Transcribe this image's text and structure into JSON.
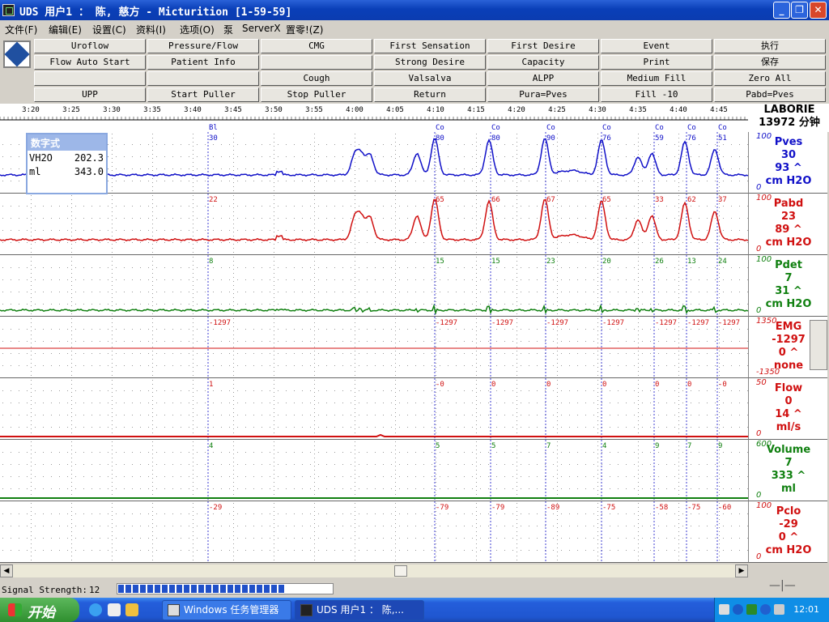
{
  "window": {
    "title": "UDS 用户1 ： 陈, 慈方 - Micturition [1-59-59]",
    "min": "_",
    "restore": "❐",
    "close": "✕"
  },
  "menu": [
    "文件(F)",
    "编辑(E)",
    "设置(C)",
    "资料(I)",
    "选项(O)",
    "泵",
    "ServerX",
    "置零!(Z)"
  ],
  "toolbar": [
    [
      "Uroflow",
      "Pressure/Flow",
      "CMG",
      "First Sensation",
      "First Desire",
      "Event",
      "执行"
    ],
    [
      "Flow Auto Start",
      "Patient Info",
      "",
      "Strong Desire",
      "Capacity",
      "Print",
      "保存"
    ],
    [
      "",
      "",
      "Cough",
      "Valsalva",
      "ALPP",
      "Medium Fill",
      "Zero All"
    ],
    [
      "UPP",
      "Start Puller",
      "Stop Puller",
      "Return",
      "Pura=Pves",
      "Fill -10",
      "Pabd=Pves"
    ]
  ],
  "timeline": {
    "ticks": [
      "3:20",
      "3:25",
      "3:30",
      "3:35",
      "3:40",
      "3:45",
      "3:50",
      "3:55",
      "4:00",
      "4:05",
      "4:10",
      "4:15",
      "4:20",
      "4:25",
      "4:30",
      "4:35",
      "4:40",
      "4:45"
    ],
    "events": [
      "Bl",
      "Co",
      "Co",
      "Co",
      "Co",
      "Co",
      "Co",
      "Co"
    ]
  },
  "header": {
    "brand": "LABORIE",
    "subtitle": "13972 分钟"
  },
  "numeric_panel": {
    "title": "数字式",
    "rows": [
      {
        "k": "VH2O",
        "v": "202.3"
      },
      {
        "k": "ml",
        "v": "343.0"
      }
    ]
  },
  "channels": [
    {
      "name": "Pves",
      "scale_top": "100",
      "scale_bottom": "0",
      "current": "30",
      "peak": "93 ^",
      "unit": "cm H2O",
      "color": "#1010c8",
      "markers": [
        "30",
        "80",
        "80",
        "90",
        "76",
        "59",
        "76",
        "51"
      ]
    },
    {
      "name": "Pabd",
      "scale_top": "100",
      "scale_bottom": "0",
      "current": "23",
      "peak": "89 ^",
      "unit": "cm H2O",
      "color": "#d01010",
      "markers": [
        "22",
        "65",
        "66",
        "67",
        "65",
        "33",
        "62",
        "37"
      ]
    },
    {
      "name": "Pdet",
      "scale_top": "100",
      "scale_bottom": "0",
      "current": "7",
      "peak": "31 ^",
      "unit": "cm H2O",
      "color": "#108010",
      "markers": [
        "8",
        "15",
        "15",
        "23",
        "20",
        "26",
        "13",
        "24"
      ]
    },
    {
      "name": "EMG",
      "scale_top": "1350",
      "scale_bottom": "-1350",
      "current": "-1297",
      "peak": "0 ^",
      "unit": "none",
      "color": "#d01010",
      "markers": [
        "-1297",
        "-1297",
        "-1297",
        "-1297",
        "-1297",
        "-1297",
        "-1297",
        "-1297"
      ]
    },
    {
      "name": "Flow",
      "scale_top": "50",
      "scale_bottom": "0",
      "current": "0",
      "peak": "14 ^",
      "unit": "ml/s",
      "color": "#d01010",
      "markers": [
        "1",
        "-0",
        "0",
        "0",
        "0",
        "0",
        "0",
        "-0"
      ]
    },
    {
      "name": "Volume",
      "scale_top": "600",
      "scale_bottom": "0",
      "current": "7",
      "peak": "333 ^",
      "unit": "ml",
      "color": "#108010",
      "markers": [
        "4",
        "5",
        "5",
        "7",
        "4",
        "9",
        "7",
        "9"
      ]
    },
    {
      "name": "Pclo",
      "scale_top": "100",
      "scale_bottom": "0",
      "current": "-29",
      "peak": "0 ^",
      "unit": "cm H2O",
      "color": "#d01010",
      "markers": [
        "-29",
        "-79",
        "-79",
        "-89",
        "-75",
        "-58",
        "-75",
        "-60"
      ]
    }
  ],
  "status": {
    "signal_label": "Signal Strength:",
    "signal_value": "12",
    "signal_fraction": 0.78
  },
  "taskbar": {
    "start": "开始",
    "tasks": [
      "Windows 任务管理器",
      "UDS 用户1 ： 陈,..."
    ],
    "clock": "12:01"
  },
  "colors": {
    "grid_dot": "#9a9a9a",
    "event_line": "#1010c8",
    "titlebar": "#0a3fb8"
  }
}
